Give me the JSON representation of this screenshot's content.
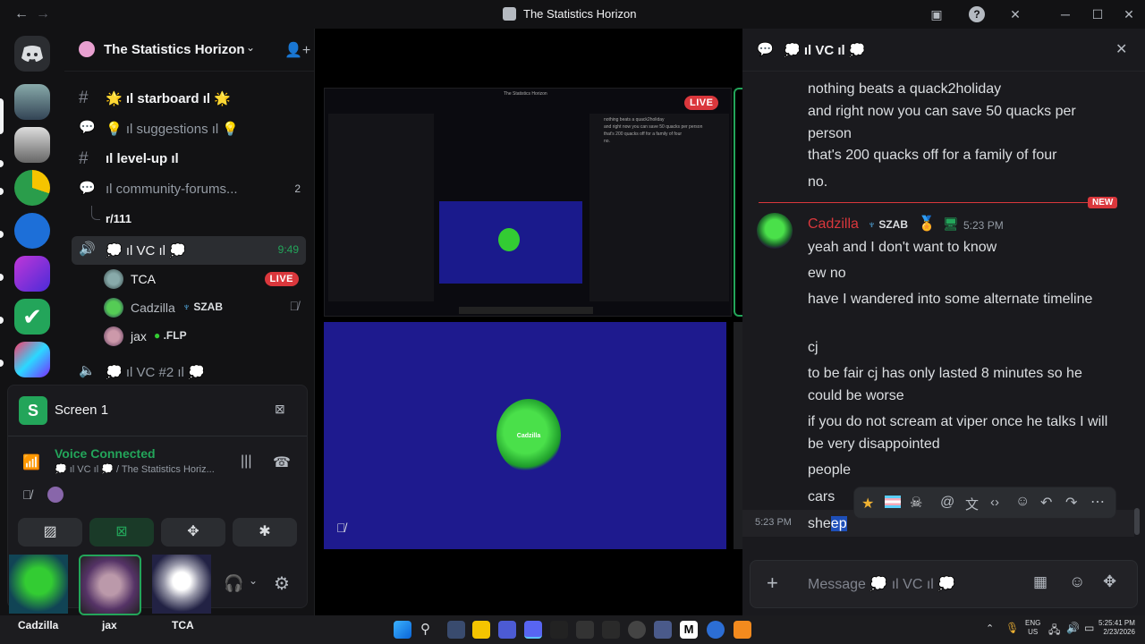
{
  "window": {
    "title": "The Statistics Horizon"
  },
  "server": {
    "name": "The Statistics Horizon"
  },
  "channels": [
    {
      "label": "🌟 ıl starboard ıl 🌟"
    },
    {
      "label": "💡 ıl suggestions ıl 💡"
    },
    {
      "label": "ıl level-up ıl"
    },
    {
      "label": "ıl community-forums...",
      "badge": "2"
    },
    {
      "label": "r/111"
    },
    {
      "label": "💭 ıl VC ıl 💭",
      "time": "9:49"
    },
    {
      "label": "💭 ıl VC #2 ıl 💭"
    }
  ],
  "voice_users": [
    {
      "name": "TCA",
      "badge": "LIVE"
    },
    {
      "name": "Cadzilla",
      "tag": "SZAB"
    },
    {
      "name": "jax",
      "tag": ".FLP"
    }
  ],
  "screen_panel": {
    "title": "Screen 1",
    "status": "Voice Connected",
    "location": "💭 ıl VC ıl 💭 / The Statistics Horiz..."
  },
  "bottom_users": [
    {
      "name": "Cadzilla"
    },
    {
      "name": "jax"
    },
    {
      "name": "TCA"
    }
  ],
  "stream": {
    "avatar_label": "Cadzilla"
  },
  "preview": {
    "title": "The Statistics Horizon",
    "live": "LIVE",
    "lines": [
      "nothing beats a quack2holiday",
      "and right now you can save 50 quacks per person",
      "that's 200 quacks off for a family of four",
      "no."
    ]
  },
  "chat": {
    "header": "💭 ıl VC ıl 💭",
    "messages_before": [
      "nothing beats a quack2holiday",
      "and right now you can save 50 quacks per person",
      "that's 200 quacks off for a family of four",
      "no."
    ],
    "new_label": "NEW",
    "author": "Cadzilla",
    "author_tag": "SZAB",
    "timestamp": "5:23 PM",
    "messages": [
      "yeah and I don't want to know",
      "ew no",
      "have I wandered into some alternate timeline",
      "cj",
      "to be fair cj has only lasted 8 minutes so he could be worse",
      "if you do not scream at viper once he talks I will be very disappointed",
      "people",
      "cars"
    ],
    "last_time": "5:23 PM",
    "last_msg_pre": "she",
    "last_msg_sel": "ep",
    "placeholder": "Message 💭 ıl VC ıl 💭"
  },
  "tray": {
    "lang1": "ENG",
    "lang2": "US",
    "time": "5:25:41 PM",
    "date": "2/23/2026"
  }
}
